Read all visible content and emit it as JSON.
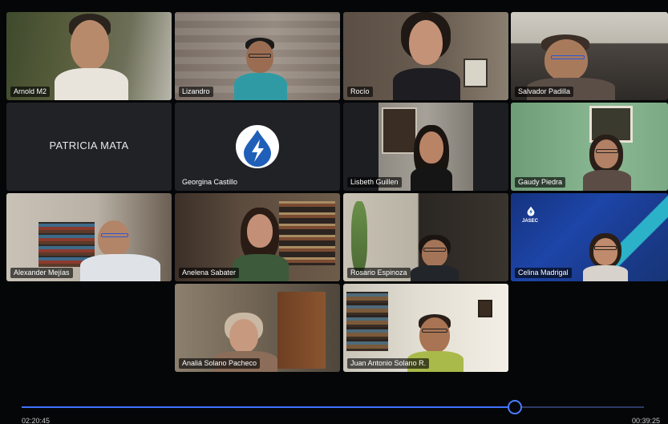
{
  "participants": [
    {
      "name": "Arnold M2"
    },
    {
      "name": "Lizandro"
    },
    {
      "name": "Rocío"
    },
    {
      "name": "Salvador Padilla"
    },
    {
      "center_label": "PATRICIA MATA"
    },
    {
      "name": "Georgina Castillo"
    },
    {
      "name": "Lisbeth Guillen"
    },
    {
      "name": "Gaudy Piedra"
    },
    {
      "name": "Alexander Mejías"
    },
    {
      "name": "Anelena Sabater"
    },
    {
      "name": "Rosario Espinoza"
    },
    {
      "name": "Celina Madrigal",
      "bg_brand": "JASEC"
    },
    {
      "name": "Analiá Solano Pacheco"
    },
    {
      "name": "Juan Antonio Solano R."
    }
  ],
  "playback": {
    "elapsed": "02:20:45",
    "total": "00:39:25",
    "progress": 0.792
  },
  "colors": {
    "accent": "#3f73ff",
    "track": "#2b3a66",
    "tile_dark": "#1e1f22",
    "logo_blue": "#1f5fb8"
  },
  "icons": {
    "georgina_avatar": "water-drop-lightning-logo",
    "jasec_logo": "water-drop-lightning-logo"
  }
}
